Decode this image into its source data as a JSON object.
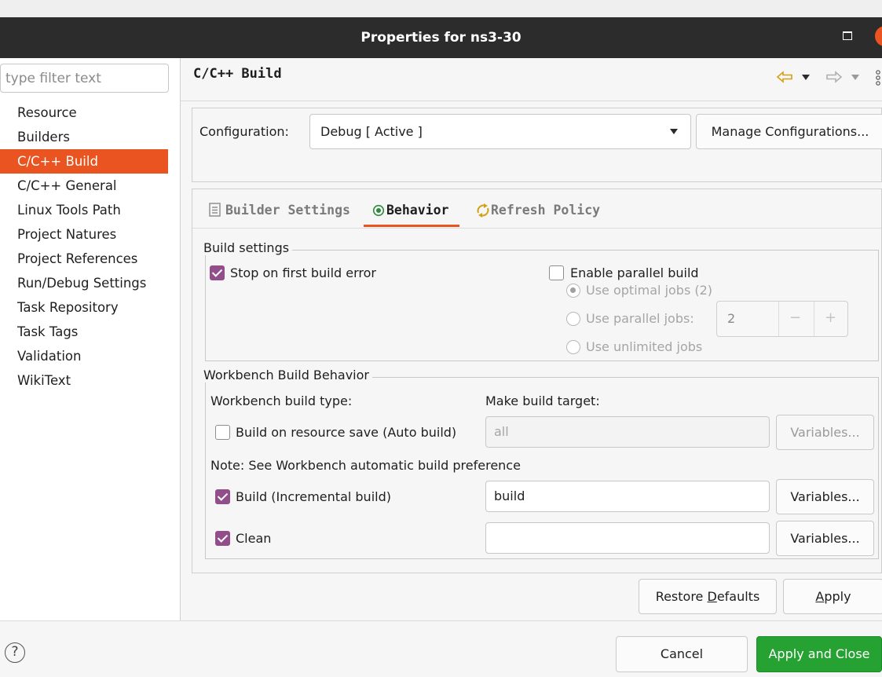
{
  "window": {
    "title": "Properties for ns3-30"
  },
  "filter": {
    "placeholder": "type filter text"
  },
  "tree": {
    "items": [
      "Resource",
      "Builders",
      "C/C++ Build",
      "C/C++ General",
      "Linux Tools Path",
      "Project Natures",
      "Project References",
      "Run/Debug Settings",
      "Task Repository",
      "Task Tags",
      "Validation",
      "WikiText"
    ],
    "selected": "C/C++ Build"
  },
  "page": {
    "title": "C/C++ Build"
  },
  "config": {
    "label": "Configuration:",
    "value": "Debug  [ Active ]",
    "manage_button": "Manage Configurations..."
  },
  "tabs": {
    "builder": "Builder Settings",
    "behavior": "Behavior",
    "refresh": "Refresh Policy",
    "active": "Behavior"
  },
  "build_settings": {
    "title": "Build settings",
    "stop_on_error": "Stop on first build error",
    "stop_on_error_checked": true,
    "parallel": "Enable parallel build",
    "parallel_checked": false,
    "optimal_jobs": "Use optimal jobs (2)",
    "parallel_jobs": "Use parallel jobs:",
    "parallel_jobs_value": "2",
    "minus": "−",
    "plus": "+",
    "unlimited_jobs": "Use unlimited jobs"
  },
  "workbench": {
    "title": "Workbench Build Behavior",
    "type_label": "Workbench build type:",
    "target_label": "Make build target:",
    "auto_build": "Build on resource save (Auto build)",
    "auto_build_checked": false,
    "auto_build_target": "all",
    "note": "Note: See Workbench automatic build preference",
    "incremental": "Build (Incremental build)",
    "incremental_checked": true,
    "incremental_target": "build",
    "clean": "Clean",
    "clean_checked": true,
    "clean_target": "",
    "variables": "Variables..."
  },
  "buttons": {
    "restore_pre": "Restore ",
    "restore_mn": "D",
    "restore_post": "efaults",
    "apply_mn": "A",
    "apply_post": "pply",
    "cancel": "Cancel",
    "apply_close": "Apply and Close",
    "help": "?"
  },
  "colors": {
    "accent": "#e95420",
    "checkbox": "#924d8b",
    "primary": "#26a232"
  }
}
